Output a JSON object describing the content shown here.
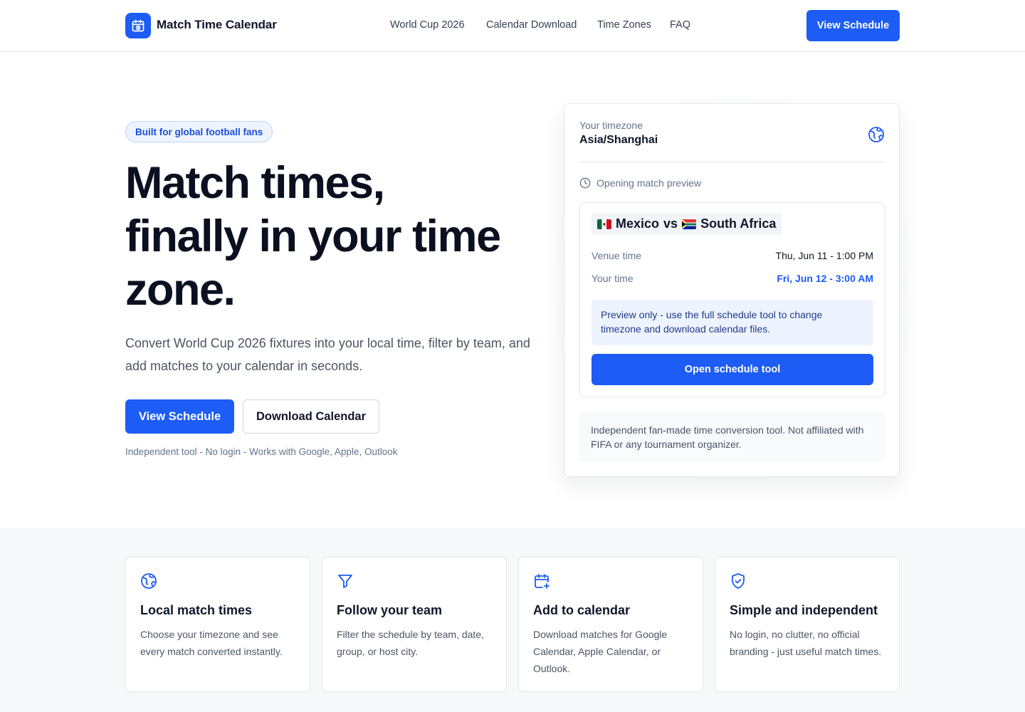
{
  "header": {
    "brand": "Match Time Calendar",
    "nav": [
      "World Cup 2026",
      "Calendar Download",
      "Time Zones",
      "FAQ"
    ],
    "cta": "View Schedule"
  },
  "hero": {
    "badge": "Built for global football fans",
    "headline_lines": [
      "Match times,",
      "finally in your time",
      "zone."
    ],
    "subtext": "Convert World Cup 2026 fixtures into your local time, filter by team, and add matches to your calendar in seconds.",
    "primary_button": "View Schedule",
    "secondary_button": "Download Calendar",
    "footnote": "Independent tool - No login - Works with Google, Apple, Outlook"
  },
  "card": {
    "timezone_label": "Your timezone",
    "timezone_value": "Asia/Shanghai",
    "preview_label": "Opening match preview",
    "team_home": "Mexico",
    "vs": "vs",
    "team_away": "South Africa",
    "venue_time_label": "Venue time",
    "venue_time_value": "Thu, Jun 11 - 1:00 PM",
    "your_time_label": "Your time",
    "your_time_value": "Fri, Jun 12 - 3:00 AM",
    "info": "Preview only - use the full schedule tool to change timezone and download calendar files.",
    "button": "Open schedule tool",
    "disclaimer": "Independent fan-made time conversion tool. Not affiliated with FIFA or any tournament organizer."
  },
  "features": [
    {
      "icon": "globe-icon",
      "title": "Local match times",
      "desc": "Choose your timezone and see every match converted instantly."
    },
    {
      "icon": "filter-icon",
      "title": "Follow your team",
      "desc": "Filter the schedule by team, date, group, or host city."
    },
    {
      "icon": "calendar-plus-icon",
      "title": "Add to calendar",
      "desc": "Download matches for Google Calendar, Apple Calendar, or Outlook."
    },
    {
      "icon": "shield-check-icon",
      "title": "Simple and independent",
      "desc": "No login, no clutter, no official branding - just useful match times."
    }
  ],
  "colors": {
    "accent": "#1d5cf5",
    "text": "#0f172a",
    "muted": "#64748b",
    "info_bg": "#eef4ff",
    "section_bg": "#f7f8fa"
  }
}
